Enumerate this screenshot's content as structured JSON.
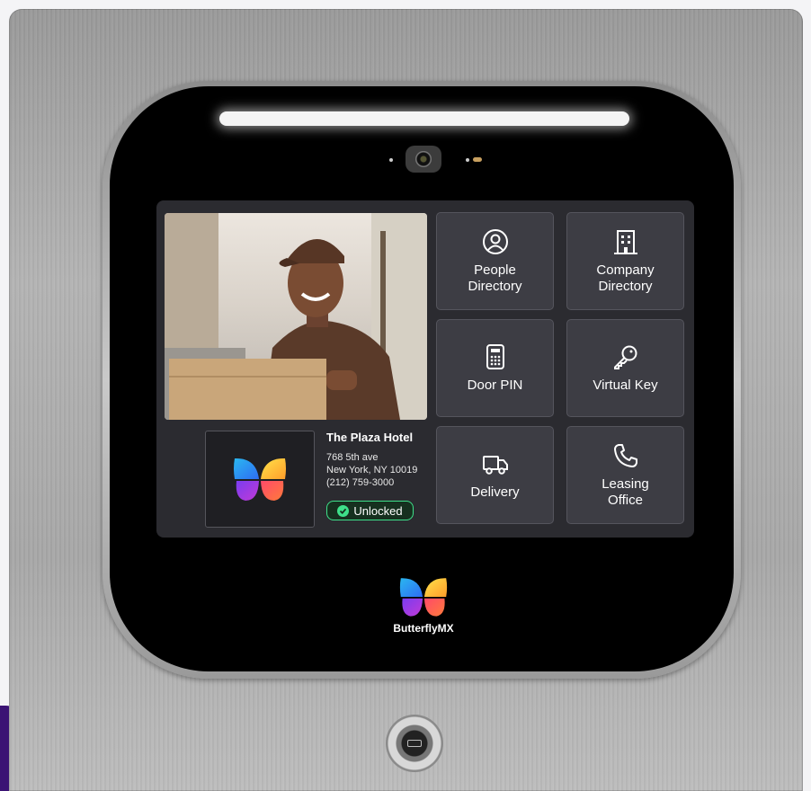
{
  "location": {
    "name": "The Plaza Hotel",
    "address_line1": "768 5th ave",
    "address_line2": "New York, NY 10019",
    "phone": "(212) 759-3000"
  },
  "status": {
    "label": "Unlocked",
    "color": "#3ee08a"
  },
  "tiles": [
    {
      "label": "People\nDirectory",
      "icon": "person-icon"
    },
    {
      "label": "Company\nDirectory",
      "icon": "building-icon"
    },
    {
      "label": "Door PIN",
      "icon": "keypad-icon"
    },
    {
      "label": "Virtual Key",
      "icon": "key-icon"
    },
    {
      "label": "Delivery",
      "icon": "truck-icon"
    },
    {
      "label": "Leasing\nOffice",
      "icon": "phone-icon"
    }
  ],
  "brand": {
    "name": "ButterflyMX"
  },
  "colors": {
    "accent_green": "#3ee08a",
    "tile_bg": "#3d3d44",
    "screen_bg": "#2b2b30"
  }
}
